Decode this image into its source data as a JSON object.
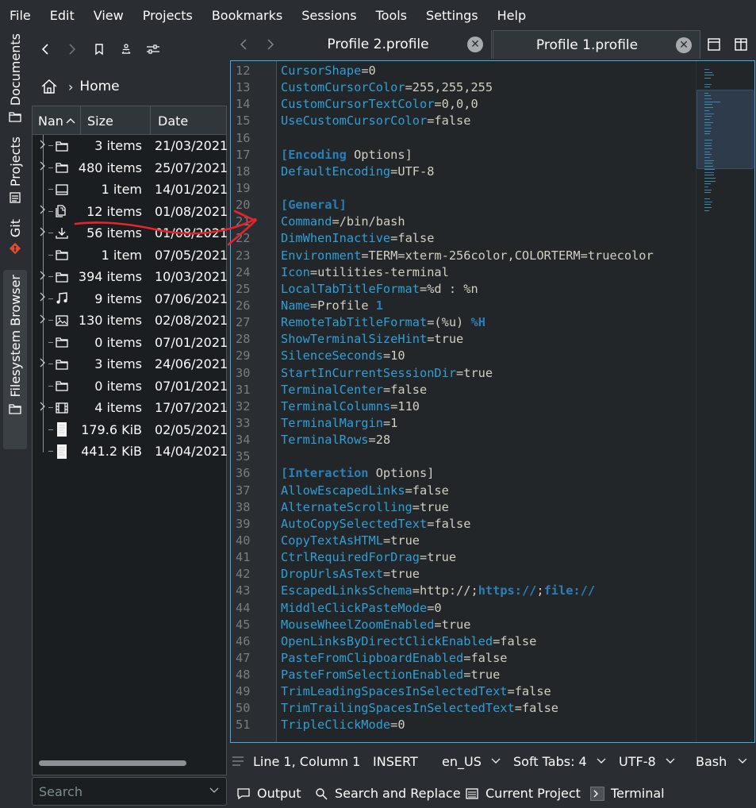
{
  "menu": [
    "File",
    "Edit",
    "View",
    "Projects",
    "Bookmarks",
    "Sessions",
    "Tools",
    "Settings",
    "Help"
  ],
  "side_tabs": {
    "documents": "Documents",
    "projects": "Projects",
    "git": "Git",
    "filesystem": "Filesystem Browser"
  },
  "file_browser": {
    "breadcrumb": "Home",
    "columns": [
      "Nan",
      "Size",
      "Date"
    ],
    "rows": [
      {
        "icon": "folder",
        "expandable": true,
        "size": "3 items",
        "date": "21/03/2021"
      },
      {
        "icon": "folder",
        "expandable": true,
        "size": "480 items",
        "date": "25/07/2021"
      },
      {
        "icon": "desktop",
        "expandable": false,
        "size": "1 item",
        "date": "14/01/2021"
      },
      {
        "icon": "documents",
        "expandable": true,
        "size": "12 items",
        "date": "01/08/2021"
      },
      {
        "icon": "download",
        "expandable": true,
        "size": "56 items",
        "date": "01/08/2021"
      },
      {
        "icon": "folder",
        "expandable": false,
        "size": "1 item",
        "date": "07/05/2021"
      },
      {
        "icon": "folder",
        "expandable": true,
        "size": "394 items",
        "date": "10/03/2021"
      },
      {
        "icon": "music",
        "expandable": true,
        "size": "9 items",
        "date": "07/06/2021"
      },
      {
        "icon": "pictures",
        "expandable": true,
        "size": "130 items",
        "date": "02/08/2021"
      },
      {
        "icon": "folder",
        "expandable": false,
        "size": "0 items",
        "date": "07/01/2021"
      },
      {
        "icon": "folder",
        "expandable": true,
        "size": "3 items",
        "date": "24/06/2021"
      },
      {
        "icon": "folder",
        "expandable": false,
        "size": "0 items",
        "date": "07/01/2021"
      },
      {
        "icon": "video",
        "expandable": true,
        "size": "4 items",
        "date": "17/07/2021"
      },
      {
        "icon": "file",
        "expandable": false,
        "size": "179.6 KiB",
        "date": "02/05/2021"
      },
      {
        "icon": "file",
        "expandable": false,
        "size": "441.2 KiB",
        "date": "14/04/2021"
      }
    ],
    "search_placeholder": "Search"
  },
  "tabs": [
    {
      "label": "Profile 2.profile",
      "active": false
    },
    {
      "label": "Profile 1.profile",
      "active": true
    }
  ],
  "editor": {
    "lines": [
      {
        "n": "12",
        "t": "kv",
        "k": "CursorShape",
        "v": "0"
      },
      {
        "n": "13",
        "t": "kv",
        "k": "CustomCursorColor",
        "v": "255,255,255"
      },
      {
        "n": "14",
        "t": "kv",
        "k": "CustomCursorTextColor",
        "v": "0,0,0"
      },
      {
        "n": "15",
        "t": "kv",
        "k": "UseCustomCursorColor",
        "v": "false"
      },
      {
        "n": "16",
        "t": "blank"
      },
      {
        "n": "17",
        "t": "sec",
        "s": "[Encoding",
        "w": " Options]"
      },
      {
        "n": "18",
        "t": "kv",
        "k": "DefaultEncoding",
        "v": "UTF-8"
      },
      {
        "n": "19",
        "t": "blank"
      },
      {
        "n": "20",
        "t": "sec",
        "s": "[General]",
        "w": ""
      },
      {
        "n": "21",
        "t": "kv",
        "k": "Command",
        "v": "/bin/bash"
      },
      {
        "n": "22",
        "t": "kv",
        "k": "DimWhenInactive",
        "v": "false"
      },
      {
        "n": "23",
        "t": "kv",
        "k": "Environment",
        "v": "TERM=xterm-256color,COLORTERM=truecolor"
      },
      {
        "n": "24",
        "t": "kv",
        "k": "Icon",
        "v": "utilities-terminal"
      },
      {
        "n": "25",
        "t": "kv",
        "k": "LocalTabTitleFormat",
        "v": "%d : %n"
      },
      {
        "n": "26",
        "t": "kvb",
        "k": "Name",
        "v": "Profile ",
        "b": "1"
      },
      {
        "n": "27",
        "t": "kvb",
        "k": "RemoteTabTitleFormat",
        "v": "(%u) ",
        "b": "%H"
      },
      {
        "n": "28",
        "t": "kv",
        "k": "ShowTerminalSizeHint",
        "v": "true"
      },
      {
        "n": "29",
        "t": "kv",
        "k": "SilenceSeconds",
        "v": "10"
      },
      {
        "n": "30",
        "t": "kv",
        "k": "StartInCurrentSessionDir",
        "v": "true"
      },
      {
        "n": "31",
        "t": "kv",
        "k": "TerminalCenter",
        "v": "false"
      },
      {
        "n": "32",
        "t": "kv",
        "k": "TerminalColumns",
        "v": "110"
      },
      {
        "n": "33",
        "t": "kv",
        "k": "TerminalMargin",
        "v": "1"
      },
      {
        "n": "34",
        "t": "kv",
        "k": "TerminalRows",
        "v": "28"
      },
      {
        "n": "35",
        "t": "blank"
      },
      {
        "n": "36",
        "t": "sec",
        "s": "[Interaction",
        "w": " Options]"
      },
      {
        "n": "37",
        "t": "kv",
        "k": "AllowEscapedLinks",
        "v": "false"
      },
      {
        "n": "38",
        "t": "kv",
        "k": "AlternateScrolling",
        "v": "true"
      },
      {
        "n": "39",
        "t": "kv",
        "k": "AutoCopySelectedText",
        "v": "false"
      },
      {
        "n": "40",
        "t": "kv",
        "k": "CopyTextAsHTML",
        "v": "true"
      },
      {
        "n": "41",
        "t": "kv",
        "k": "CtrlRequiredForDrag",
        "v": "true"
      },
      {
        "n": "42",
        "t": "kv",
        "k": "DropUrlsAsText",
        "v": "true"
      },
      {
        "n": "43",
        "t": "kvl",
        "k": "EscapedLinksSchema",
        "v": "http://;",
        "b1": "https://",
        "m": ";",
        "b2": "file://"
      },
      {
        "n": "44",
        "t": "kv",
        "k": "MiddleClickPasteMode",
        "v": "0"
      },
      {
        "n": "45",
        "t": "kv",
        "k": "MouseWheelZoomEnabled",
        "v": "true"
      },
      {
        "n": "46",
        "t": "kv",
        "k": "OpenLinksByDirectClickEnabled",
        "v": "false"
      },
      {
        "n": "47",
        "t": "kv",
        "k": "PasteFromClipboardEnabled",
        "v": "false"
      },
      {
        "n": "48",
        "t": "kv",
        "k": "PasteFromSelectionEnabled",
        "v": "true"
      },
      {
        "n": "49",
        "t": "kv",
        "k": "TrimLeadingSpacesInSelectedText",
        "v": "false"
      },
      {
        "n": "50",
        "t": "kv",
        "k": "TrimTrailingSpacesInSelectedText",
        "v": "false"
      },
      {
        "n": "51",
        "t": "kv",
        "k": "TripleClickMode",
        "v": "0"
      }
    ]
  },
  "status": {
    "position": "Line 1, Column 1",
    "mode": "INSERT",
    "language": "en_US",
    "indent": "Soft Tabs: 4",
    "encoding": "UTF-8",
    "syntax": "Bash"
  },
  "bottom": {
    "output": "Output",
    "search": "Search and Replace",
    "project": "Current Project",
    "terminal": "Terminal"
  },
  "colors": {
    "accent": "#3daee9",
    "key": "#2f9fd6",
    "section": "#2980b9",
    "annotation": "#e8232a"
  }
}
